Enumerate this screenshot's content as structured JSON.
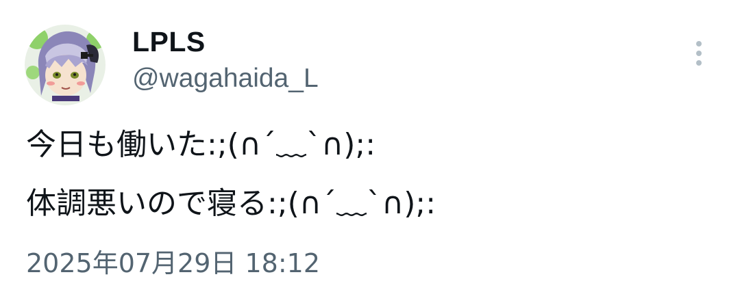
{
  "author": {
    "display_name": "LPLS",
    "handle": "@wagahaida_L",
    "avatar_icon": "avatar-image"
  },
  "tweet": {
    "lines": [
      "今日も働いた:;(∩´﹏`∩);:",
      "体調悪いので寝る:;(∩´﹏`∩);:"
    ],
    "timestamp": "2025年07月29日 18:12"
  },
  "menu": {
    "icon": "more-vertical-icon"
  },
  "colors": {
    "text_primary": "#0f1419",
    "text_secondary": "#536471",
    "menu_dots": "#b3bfc7"
  }
}
